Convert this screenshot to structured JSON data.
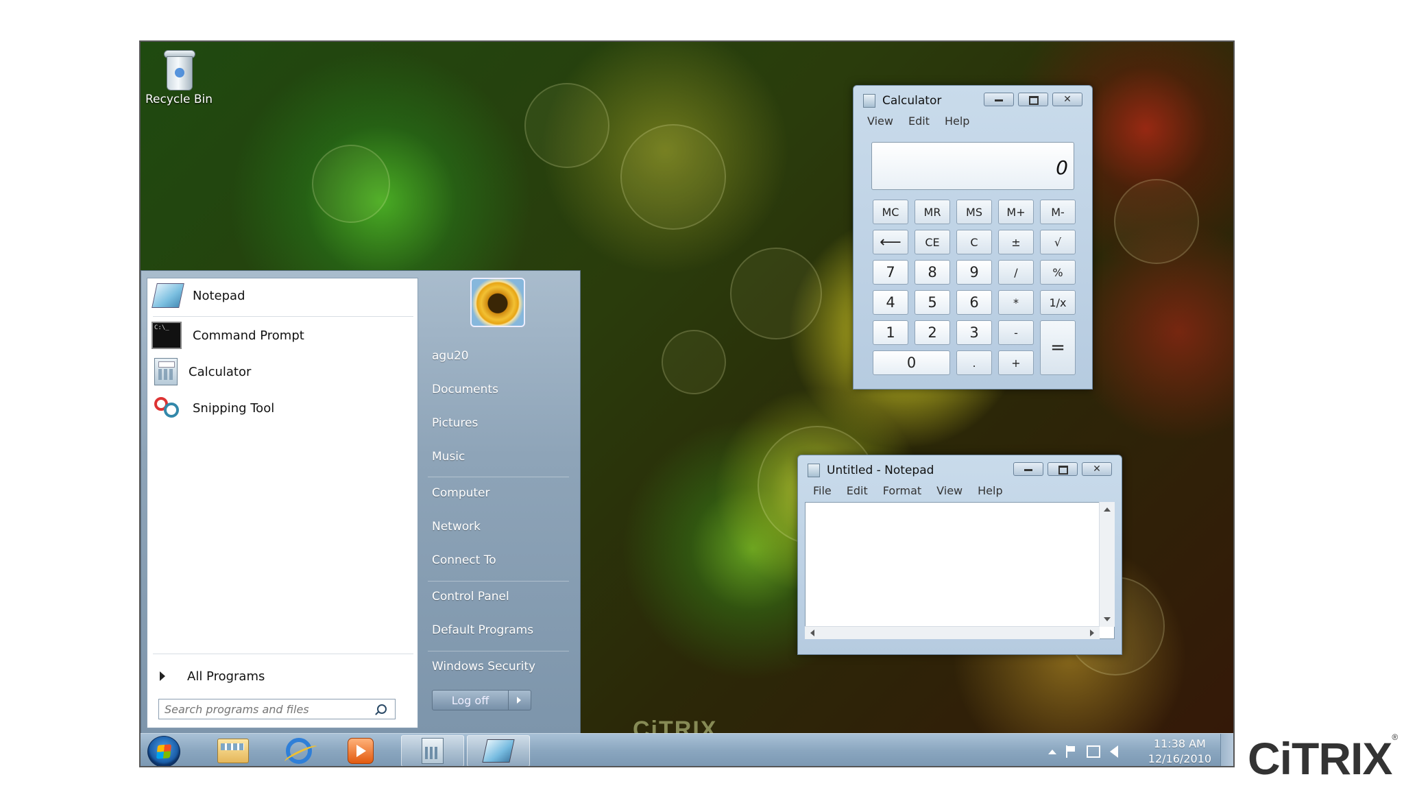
{
  "desktop": {
    "recycle_bin_label": "Recycle Bin",
    "watermark": "CiTRIX",
    "brand": "CiTRIX"
  },
  "start_menu": {
    "pinned": [
      {
        "label": "Notepad",
        "icon": "notepad-icon"
      },
      {
        "label": "Command Prompt",
        "icon": "command-prompt-icon"
      },
      {
        "label": "Calculator",
        "icon": "calculator-icon"
      },
      {
        "label": "Snipping Tool",
        "icon": "snipping-tool-icon"
      }
    ],
    "all_programs": "All Programs",
    "search_placeholder": "Search programs and files",
    "right": {
      "user": "agu20",
      "documents": "Documents",
      "pictures": "Pictures",
      "music": "Music",
      "computer": "Computer",
      "network": "Network",
      "connect_to": "Connect To",
      "control_panel": "Control Panel",
      "default_programs": "Default Programs",
      "windows_security": "Windows Security"
    },
    "log_off": "Log off"
  },
  "calculator": {
    "title": "Calculator",
    "menu": [
      "View",
      "Edit",
      "Help"
    ],
    "display": "0",
    "buttons": {
      "mc": "MC",
      "mr": "MR",
      "ms": "MS",
      "mplus": "M+",
      "mminus": "M-",
      "back": "⟵",
      "ce": "CE",
      "c": "C",
      "pm": "±",
      "sqrt": "√",
      "n7": "7",
      "n8": "8",
      "n9": "9",
      "div": "/",
      "pct": "%",
      "n4": "4",
      "n5": "5",
      "n6": "6",
      "mul": "*",
      "inv": "1/x",
      "n1": "1",
      "n2": "2",
      "n3": "3",
      "sub": "-",
      "eq": "=",
      "n0": "0",
      "dot": ".",
      "add": "+"
    }
  },
  "notepad": {
    "title": "Untitled - Notepad",
    "menu": [
      "File",
      "Edit",
      "Format",
      "View",
      "Help"
    ],
    "content": ""
  },
  "taskbar": {
    "time": "11:38 AM",
    "date": "12/16/2010"
  }
}
